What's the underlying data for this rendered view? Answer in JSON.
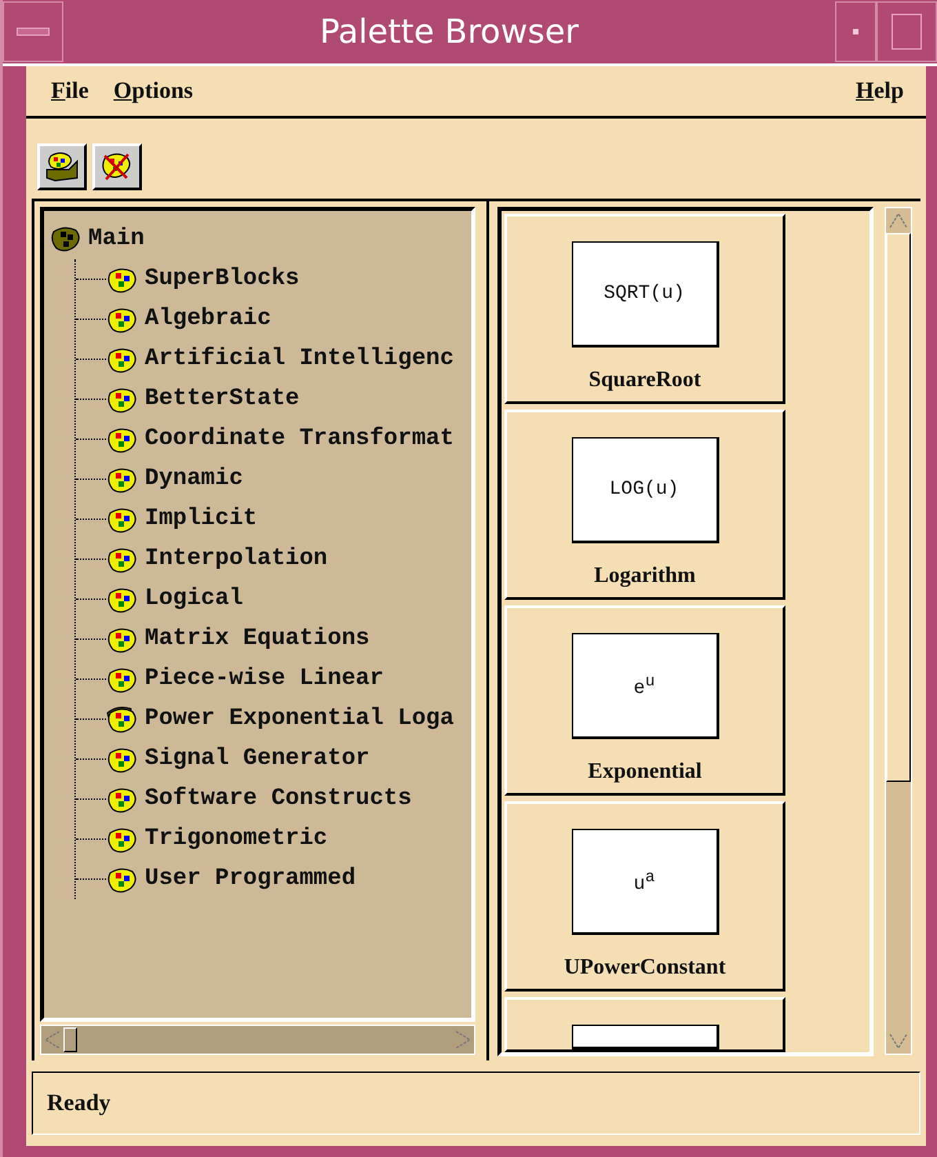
{
  "window": {
    "title": "Palette Browser"
  },
  "menu": [
    {
      "mnemonic": "F",
      "rest": "ile"
    },
    {
      "mnemonic": "O",
      "rest": "ptions"
    }
  ],
  "help_menu": {
    "mnemonic": "H",
    "rest": "elp"
  },
  "tree": {
    "label": "Main",
    "children": [
      {
        "label": "SuperBlocks",
        "open": false
      },
      {
        "label": "Algebraic",
        "open": false
      },
      {
        "label": "Artificial Intelligenc",
        "open": false
      },
      {
        "label": "BetterState",
        "open": false
      },
      {
        "label": "Coordinate Transformat",
        "open": false
      },
      {
        "label": "Dynamic",
        "open": false
      },
      {
        "label": "Implicit",
        "open": false
      },
      {
        "label": "Interpolation",
        "open": false
      },
      {
        "label": "Logical",
        "open": false
      },
      {
        "label": "Matrix Equations",
        "open": false
      },
      {
        "label": "Piece-wise Linear",
        "open": false
      },
      {
        "label": "Power Exponential Loga",
        "open": true
      },
      {
        "label": "Signal Generator",
        "open": false
      },
      {
        "label": "Software Constructs",
        "open": false
      },
      {
        "label": "Trigonometric",
        "open": false
      },
      {
        "label": "User Programmed",
        "open": false
      }
    ]
  },
  "blocks": [
    {
      "expression": "SQRT(u)",
      "name": "SquareRoot"
    },
    {
      "expression": "LOG(u)",
      "name": "Logarithm"
    },
    {
      "expression": "e$^{u}$",
      "name": "Exponential"
    },
    {
      "expression": "u$^{a}$",
      "name": "UPowerConstant"
    }
  ],
  "status_bar": "Ready"
}
